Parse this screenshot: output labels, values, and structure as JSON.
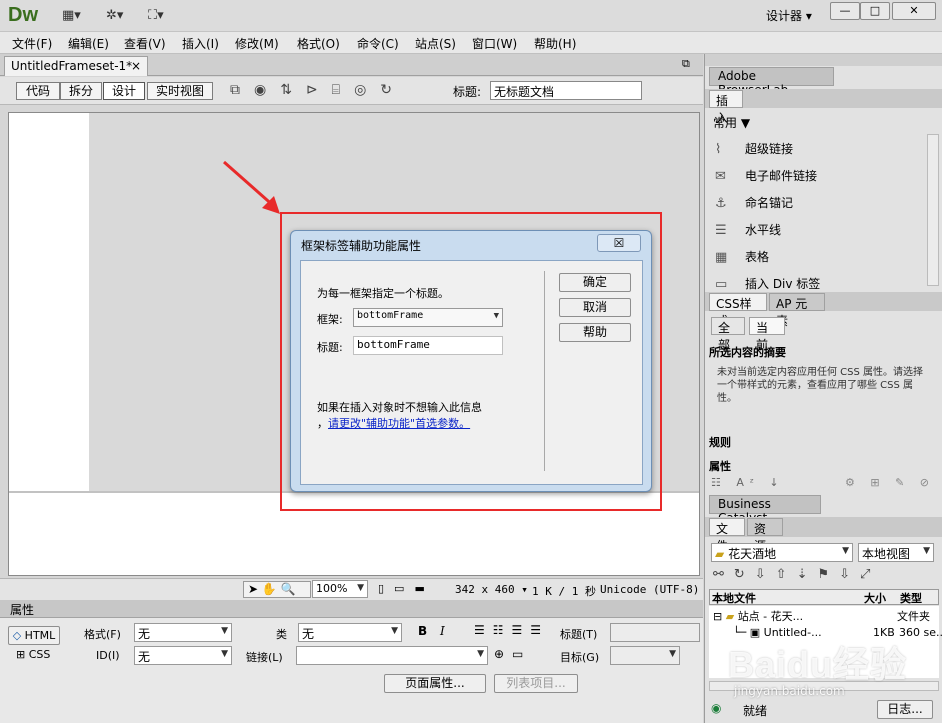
{
  "app": {
    "logo": "Dw",
    "workspace": "设计器",
    "window_buttons": [
      "—",
      "□",
      "✕"
    ]
  },
  "menu": [
    "文件(F)",
    "编辑(E)",
    "查看(V)",
    "插入(I)",
    "修改(M)",
    "格式(O)",
    "命令(C)",
    "站点(S)",
    "窗口(W)",
    "帮助(H)"
  ],
  "document_tab": {
    "label": "UntitledFrameset-1*",
    "close": "×"
  },
  "toolbar": {
    "views": [
      "代码",
      "拆分",
      "设计",
      "实时视图"
    ],
    "active_view": "设计",
    "title_label": "标题:",
    "title_value": "无标题文档"
  },
  "dialog": {
    "title": "框架标签辅助功能属性",
    "close": "☒",
    "instruction": "为每一框架指定一个标题。",
    "frame_label": "框架:",
    "frame_value": "bottomFrame",
    "title_label": "标题:",
    "title_value": "bottomFrame",
    "note_line1": "如果在插入对象时不想输入此信息",
    "note_prefix": "，",
    "note_link": "请更改\"辅助功能\"首选参数。",
    "buttons": {
      "ok": "确定",
      "cancel": "取消",
      "help": "帮助"
    }
  },
  "status": {
    "zoom": "100%",
    "dimensions": "342 x 460",
    "size_info": "1 K / 1 秒",
    "encoding": "Unicode (UTF-8)"
  },
  "properties": {
    "header": "属性",
    "html_btn": "HTML",
    "css_btn": "CSS",
    "format_label": "格式(F)",
    "format_value": "无",
    "class_label": "类",
    "class_value": "无",
    "id_label": "ID(I)",
    "id_value": "无",
    "link_label": "链接(L)",
    "link_value": "",
    "title_label": "标题(T)",
    "target_label": "目标(G)",
    "bold": "B",
    "italic": "I",
    "page_props": "页面属性...",
    "list_item": "列表项目..."
  },
  "panels": {
    "browserlab": "Adobe BrowserLab",
    "insert_tab": "插入",
    "insert_category": "常用",
    "insert_items": [
      {
        "icon": "hyperlink-icon",
        "glyph": "⌇",
        "label": "超级链接"
      },
      {
        "icon": "email-icon",
        "glyph": "✉",
        "label": "电子邮件链接"
      },
      {
        "icon": "anchor-icon",
        "glyph": "⚓",
        "label": "命名锚记"
      },
      {
        "icon": "hr-icon",
        "glyph": "☰",
        "label": "水平线"
      },
      {
        "icon": "table-icon",
        "glyph": "▦",
        "label": "表格"
      },
      {
        "icon": "div-icon",
        "glyph": "▭",
        "label": "插入 Div 标签"
      }
    ],
    "css_tabs": [
      "CSS样式",
      "AP 元素"
    ],
    "css_subtabs": [
      "全部",
      "当前"
    ],
    "css_section_title": "所选内容的摘要",
    "css_section_body": "未对当前选定内容应用任何 CSS 属性。请选择一个带样式的元素，查看应用了哪些 CSS 属性。",
    "css_rules": "规则",
    "css_properties": "属性",
    "business_catalyst": "Business Catalyst",
    "files_tabs": [
      "文件",
      "资源"
    ],
    "site_select": "花天酒地",
    "view_select": "本地视图",
    "file_headers": {
      "name": "本地文件",
      "size": "大小",
      "type": "类型"
    },
    "file_rows": [
      {
        "name": "站点 - 花天...",
        "size": "",
        "type": "文件夹"
      },
      {
        "name": "Untitled-...",
        "size": "1KB",
        "type": "360 se..."
      }
    ],
    "ready": "就绪",
    "log_button": "日志..."
  },
  "watermark": {
    "logo": "Baidu经验",
    "url": "jingyan.baidu.com"
  },
  "colors": {
    "highlight": "#e82a2a",
    "dialog_frame": "#c9dcef",
    "link": "#0a24c8"
  }
}
